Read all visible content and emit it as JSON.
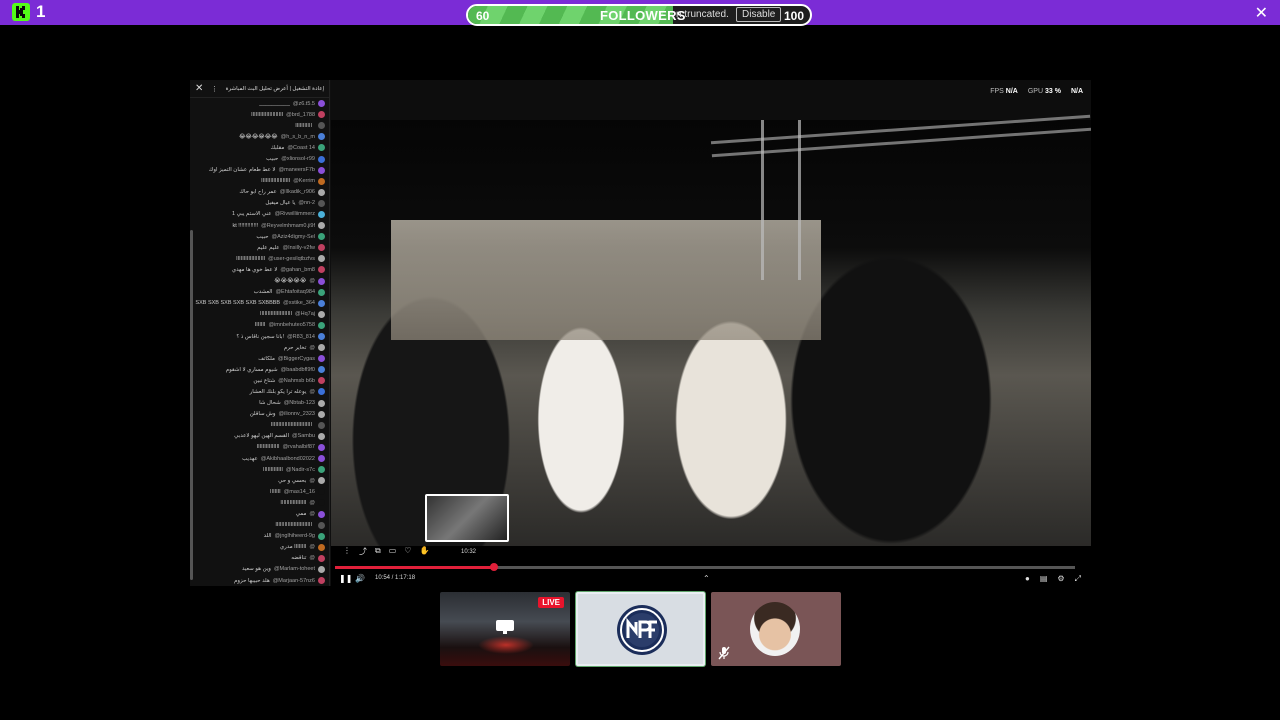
{
  "top_bar": {
    "platform_count": "1",
    "goal": {
      "current": "60",
      "target": "100",
      "title": "FOLLOWERS",
      "note": "n truncated.",
      "disable_label": "Disable",
      "progress": 0.6
    },
    "accent_color": "#7b2cd6",
    "close_icon": "close-icon"
  },
  "chat": {
    "header": "إعادة التشغيل | أعرض تحليل البث المباشرة",
    "messages": [
      {
        "user": "@z6.t5.5",
        "text": "__________",
        "color": "#8a4fd8"
      },
      {
        "user": "@brd_1788",
        "text": "ااااااااااااااااااااا",
        "color": "#c04060"
      },
      {
        "user": "",
        "text": "ااااااااااا",
        "color": "#555"
      },
      {
        "user": "@h_s_b_n_m",
        "text": "😂😂😂😂😂😂",
        "color": "#4a7fd8"
      },
      {
        "user": "@Coast 14",
        "text": "مقلبك",
        "color": "#3aa37a"
      },
      {
        "user": "@xlionsol-r99",
        "text": "حبيب",
        "color": "#3a6fd8"
      },
      {
        "user": "@maneersF7b",
        "text": "لا عط طعام عشان التميز اوك",
        "color": "#8a4fd8"
      },
      {
        "user": "@Kerrim",
        "text": "ااااااااااااااااااا",
        "color": "#c06a20"
      },
      {
        "user": "@Ilkadik_r906",
        "text": "عمر راح ابو حاك",
        "color": "#aaa"
      },
      {
        "user": "@nn-2",
        "text": "يا عيال ميفيل",
        "color": "#555"
      },
      {
        "user": "@Rivwilliimmerz",
        "text": "عني الاستم يبي 1",
        "color": "#4ab0d8"
      },
      {
        "user": "@Reyvelmhmam0.ji9f",
        "text": "kt !!!!!!!!!!!!!",
        "color": "#aaa"
      },
      {
        "user": "@Aziz4digmy-Sel",
        "text": "حبيب",
        "color": "#3aa37a"
      },
      {
        "user": "@Insilly-v2fw",
        "text": "عليم عليم",
        "color": "#c04060"
      },
      {
        "user": "@user-gesilqtbzfvs",
        "text": "ااااااااااااااااااا",
        "color": "#aaa"
      },
      {
        "user": "@gahan_bm8",
        "text": "لا عط خوي ها مهدي",
        "color": "#c04060"
      },
      {
        "user": "@",
        "text": "😭😭😭😭😭",
        "color": "#8a4fd8"
      },
      {
        "user": "@Ehtafoitaq984",
        "text": "العشدب",
        "color": "#3aa37a"
      },
      {
        "user": "@xstike_364",
        "text": "SXB SXB SXB SXB SXB SXBBBB",
        "color": "#4a7fd8"
      },
      {
        "user": "@Hq7aj",
        "text": "ااااااااااااااااااااا",
        "color": "#aaa"
      },
      {
        "user": "@imnbehuteo5758",
        "text": "ااااااا",
        "color": "#3aa37a"
      },
      {
        "user": "@R83_814",
        "text": "بانا سجين ناقاس ذ ؟!",
        "color": "#4a7fd8"
      },
      {
        "user": "@",
        "text": "تخاير حرم",
        "color": "#aaa"
      },
      {
        "user": "@BiggerCygas",
        "text": "ملكاتف",
        "color": "#8a4fd8"
      },
      {
        "user": "@baabdbfl9f0",
        "text": "شيوم مساري لا اشقوم",
        "color": "#4a7fd8"
      },
      {
        "user": "@Nahmsb b6b",
        "text": "شتاع نبين",
        "color": "#c04060"
      },
      {
        "user": "@",
        "text": "يوعله ترا يكو بلنك العشار",
        "color": "#3a6fd8"
      },
      {
        "user": "@Nbtab-123",
        "text": "شحال شا",
        "color": "#aaa"
      },
      {
        "user": "@ilionnv_2323",
        "text": "وش ساقلن",
        "color": "#aaa"
      },
      {
        "user": "",
        "text": "ااااااااااااااااااااااااااا",
        "color": "#555"
      },
      {
        "user": "@Sambu",
        "text": "القسم الهين ليهو لاعدبي",
        "color": "#aaa"
      },
      {
        "user": "@rvahalbif87",
        "text": "ااااااااااااااا",
        "color": "#8a4fd8"
      },
      {
        "user": "@Akibhaalbond02022",
        "text": "عهديب",
        "color": "#8a4fd8"
      },
      {
        "user": "@Nadir-s7c",
        "text": "ااااااااااااا",
        "color": "#3aa37a"
      },
      {
        "user": "@",
        "text": "بحسي و حي",
        "color": "#aaa"
      },
      {
        "user": "@mas14_16",
        "text": "ااااااا",
        "color": "#111"
      },
      {
        "user": "@",
        "text": "ااااااااااااااااا",
        "color": "#111"
      },
      {
        "user": "@",
        "text": "ممي",
        "color": "#8a4fd8"
      },
      {
        "user": "",
        "text": "اااااااااااااااااااااااا",
        "color": "#555"
      },
      {
        "user": "@jnglhiheerd-9g",
        "text": "اللد",
        "color": "#3aa37a"
      },
      {
        "user": "@",
        "text": "اااااااا مدري",
        "color": "#c06a20"
      },
      {
        "user": "@",
        "text": "تناقضه",
        "color": "#c04060"
      },
      {
        "user": "@Marlam-toheet",
        "text": "وين هو سعيد",
        "color": "#aaa"
      },
      {
        "user": "@Marjaan-57nz6",
        "text": "هلد حبيبها حزوم",
        "color": "#c04060"
      }
    ]
  },
  "video": {
    "stats": [
      {
        "label": "FPS",
        "value": "N/A"
      },
      {
        "label": "GPU",
        "value": "33 %"
      },
      {
        "label": "",
        "value": "N/A"
      }
    ],
    "seek_label": "10:32",
    "time": "10:54 / 1:17:18",
    "progress": 0.215
  },
  "thumbnails": {
    "live_badge": "LIVE"
  }
}
